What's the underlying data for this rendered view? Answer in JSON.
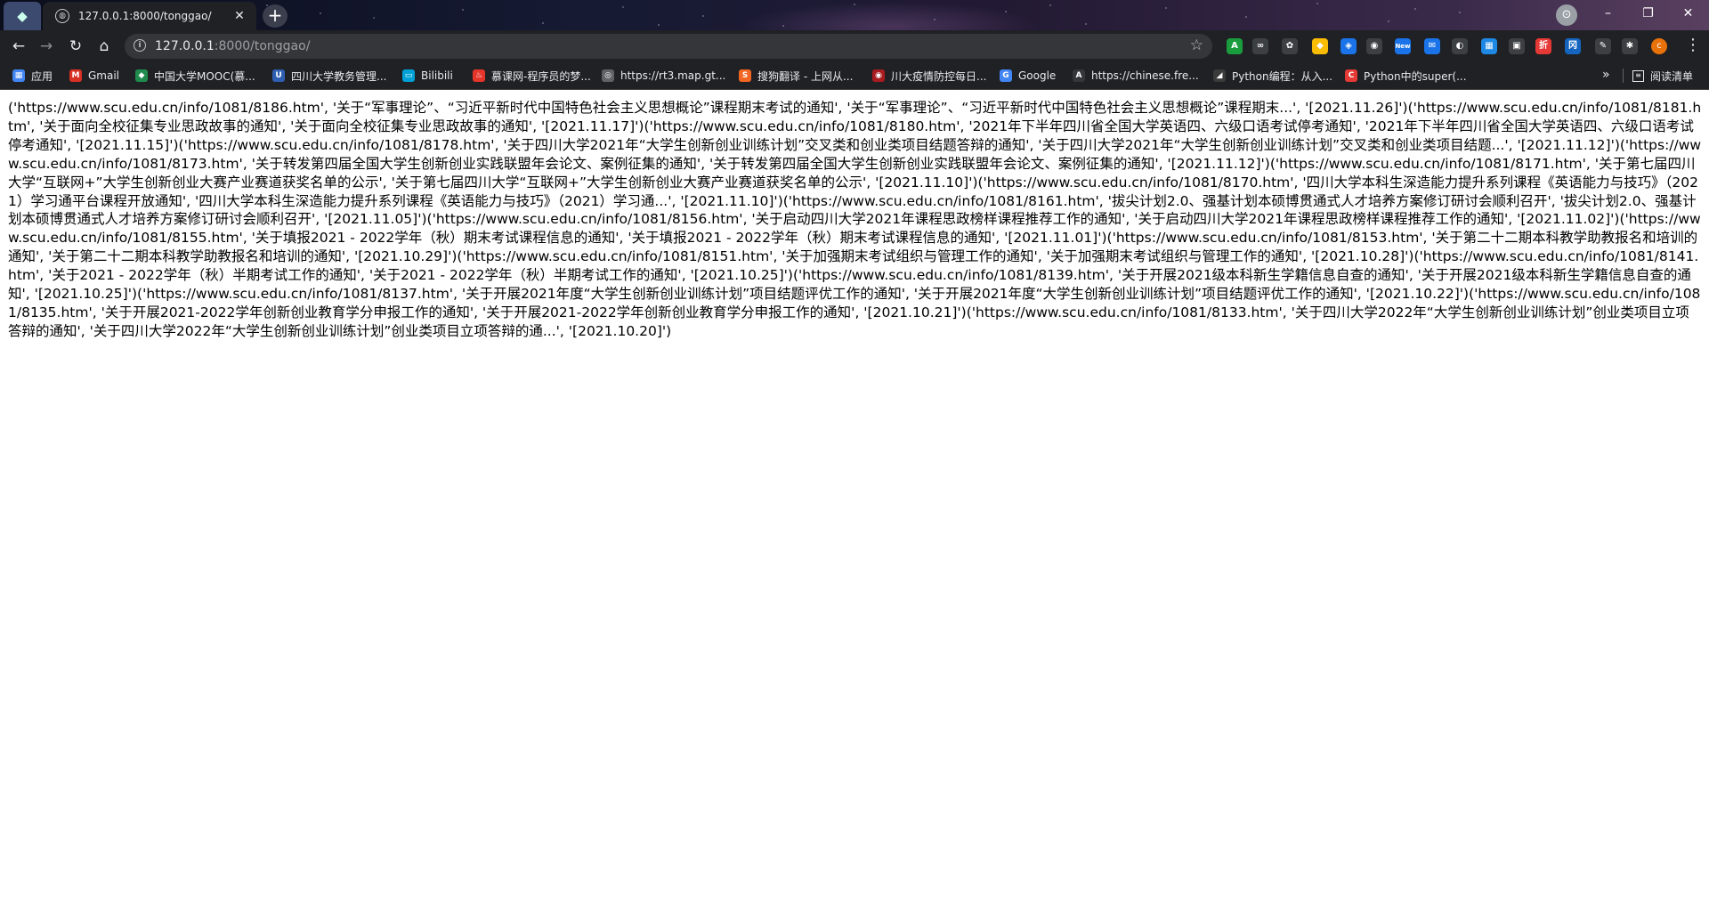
{
  "browser": {
    "tab": {
      "title": "127.0.0.1:8000/tonggao/",
      "close": "✕"
    },
    "new_tab": "+",
    "window_controls": {
      "minimize": "–",
      "maximize": "❐",
      "close": "✕"
    },
    "address": {
      "host": "127.0.0.1",
      "path": ":8000/tonggao/"
    },
    "extensions": [
      "A",
      "∞",
      "✿",
      "◆",
      "◈",
      "◉",
      "New",
      "✉",
      "◐",
      "▦",
      "▣",
      "折",
      "冈",
      "✎",
      "✱"
    ],
    "avatar": "c",
    "menu": "⋮"
  },
  "bookmarks": {
    "items": [
      {
        "label": "应用",
        "icon": "▦",
        "color": "#4285f4"
      },
      {
        "label": "Gmail",
        "icon": "M",
        "color": "#d93025"
      },
      {
        "label": "中国大学MOOC(慕...",
        "icon": "◆",
        "color": "#1f8c4e"
      },
      {
        "label": "四川大学教务管理...",
        "icon": "U",
        "color": "#2f5fb3"
      },
      {
        "label": "Bilibili",
        "icon": "▭",
        "color": "#00a1d6"
      },
      {
        "label": "慕课网-程序员的梦...",
        "icon": "♨",
        "color": "#e5352b"
      },
      {
        "label": "https://rt3.map.gt...",
        "icon": "◎",
        "color": "#5f6368"
      },
      {
        "label": "搜狗翻译 - 上网从...",
        "icon": "S",
        "color": "#f26522"
      },
      {
        "label": "川大疫情防控每日...",
        "icon": "◉",
        "color": "#a81c20"
      },
      {
        "label": "Google",
        "icon": "G",
        "color": "#4285f4"
      },
      {
        "label": "https://chinese.fre...",
        "icon": "A",
        "color": "#35363a"
      },
      {
        "label": "Python编程：从入...",
        "icon": "◢",
        "color": "#3a3a3a"
      },
      {
        "label": "Python中的super(...",
        "icon": "C",
        "color": "#e53935"
      }
    ],
    "more": "»",
    "reading_list": "阅读清单"
  },
  "page": {
    "raw_text": "('https://www.scu.edu.cn/info/1081/8186.htm', '关于“军事理论”、“习近平新时代中国特色社会主义思想概论”课程期末考试的通知', '关于“军事理论”、“习近平新时代中国特色社会主义思想概论”课程期末...', '[2021.11.26]')('https://www.scu.edu.cn/info/1081/8181.htm', '关于面向全校征集专业思政故事的通知', '关于面向全校征集专业思政故事的通知', '[2021.11.17]')('https://www.scu.edu.cn/info/1081/8180.htm', '2021年下半年四川省全国大学英语四、六级口语考试停考通知', '2021年下半年四川省全国大学英语四、六级口语考试停考通知', '[2021.11.15]')('https://www.scu.edu.cn/info/1081/8178.htm', '关于四川大学2021年“大学生创新创业训练计划”交叉类和创业类项目结题答辩的通知', '关于四川大学2021年“大学生创新创业训练计划”交叉类和创业类项目结题...', '[2021.11.12]')('https://www.scu.edu.cn/info/1081/8173.htm', '关于转发第四届全国大学生创新创业实践联盟年会论文、案例征集的通知', '关于转发第四届全国大学生创新创业实践联盟年会论文、案例征集的通知', '[2021.11.12]')('https://www.scu.edu.cn/info/1081/8171.htm', '关于第七届四川大学“互联网+”大学生创新创业大赛产业赛道获奖名单的公示', '关于第七届四川大学“互联网+”大学生创新创业大赛产业赛道获奖名单的公示', '[2021.11.10]')('https://www.scu.edu.cn/info/1081/8170.htm', '四川大学本科生深造能力提升系列课程《英语能力与技巧》（2021）学习通平台课程开放通知', '四川大学本科生深造能力提升系列课程《英语能力与技巧》（2021）学习通...', '[2021.11.10]')('https://www.scu.edu.cn/info/1081/8161.htm', '拔尖计划2.0、强基计划本硕博贯通式人才培养方案修订研讨会顺利召开', '拔尖计划2.0、强基计划本硕博贯通式人才培养方案修订研讨会顺利召开', '[2021.11.05]')('https://www.scu.edu.cn/info/1081/8156.htm', '关于启动四川大学2021年课程思政榜样课程推荐工作的通知', '关于启动四川大学2021年课程思政榜样课程推荐工作的通知', '[2021.11.02]')('https://www.scu.edu.cn/info/1081/8155.htm', '关于填报2021 - 2022学年（秋）期末考试课程信息的通知', '关于填报2021 - 2022学年（秋）期末考试课程信息的通知', '[2021.11.01]')('https://www.scu.edu.cn/info/1081/8153.htm', '关于第二十二期本科教学助教报名和培训的通知', '关于第二十二期本科教学助教报名和培训的通知', '[2021.10.29]')('https://www.scu.edu.cn/info/1081/8151.htm', '关于加强期末考试组织与管理工作的通知', '关于加强期末考试组织与管理工作的通知', '[2021.10.28]')('https://www.scu.edu.cn/info/1081/8141.htm', '关于2021 - 2022学年（秋）半期考试工作的通知', '关于2021 - 2022学年（秋）半期考试工作的通知', '[2021.10.25]')('https://www.scu.edu.cn/info/1081/8139.htm', '关于开展2021级本科新生学籍信息自查的通知', '关于开展2021级本科新生学籍信息自查的通知', '[2021.10.25]')('https://www.scu.edu.cn/info/1081/8137.htm', '关于开展2021年度“大学生创新创业训练计划”项目结题评优工作的通知', '关于开展2021年度“大学生创新创业训练计划”项目结题评优工作的通知', '[2021.10.22]')('https://www.scu.edu.cn/info/1081/8135.htm', '关于开展2021-2022学年创新创业教育学分申报工作的通知', '关于开展2021-2022学年创新创业教育学分申报工作的通知', '[2021.10.21]')('https://www.scu.edu.cn/info/1081/8133.htm', '关于四川大学2022年“大学生创新创业训练计划”创业类项目立项答辩的通知', '关于四川大学2022年“大学生创新创业训练计划”创业类项目立项答辩的通...', '[2021.10.20]')"
  }
}
